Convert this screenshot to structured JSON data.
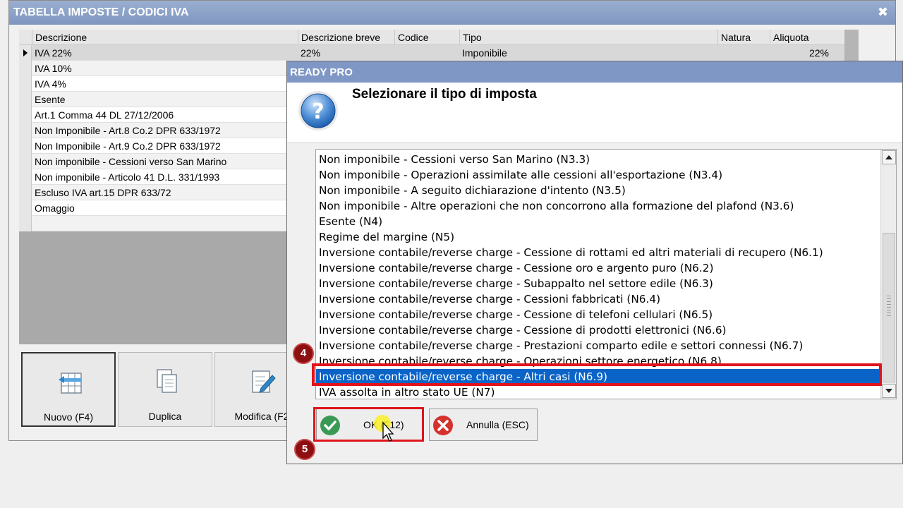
{
  "main_window": {
    "title": "TABELLA IMPOSTE / CODICI IVA",
    "close_glyph": "✖",
    "columns": [
      "Descrizione",
      "Descrizione breve",
      "Codice",
      "Tipo",
      "Natura",
      "Aliquota"
    ],
    "rows": [
      {
        "descrizione": "IVA 22%",
        "descrizione_breve": "22%",
        "codice": "",
        "tipo": "Imponibile",
        "natura": "",
        "aliquota": "22%"
      },
      {
        "descrizione": "IVA 10%"
      },
      {
        "descrizione": "IVA 4%"
      },
      {
        "descrizione": "Esente"
      },
      {
        "descrizione": "Art.1 Comma 44 DL 27/12/2006"
      },
      {
        "descrizione": "Non Imponibile - Art.8 Co.2 DPR 633/1972"
      },
      {
        "descrizione": "Non Imponibile - Art.9 Co.2 DPR 633/1972"
      },
      {
        "descrizione": "Non imponibile - Cessioni verso San Marino"
      },
      {
        "descrizione": "Non imponibile - Articolo 41 D.L. 331/1993"
      },
      {
        "descrizione": "Escluso IVA art.15 DPR 633/72"
      },
      {
        "descrizione": "Omaggio"
      },
      {
        "descrizione": ""
      }
    ],
    "toolbar": [
      {
        "label": "Nuovo (F4)",
        "icon": "new-record-icon"
      },
      {
        "label": "Duplica",
        "icon": "duplicate-icon"
      },
      {
        "label": "Modifica (F2",
        "icon": "edit-icon"
      }
    ]
  },
  "dialog": {
    "title": "READY PRO",
    "prompt": "Selezionare il tipo di imposta",
    "icon": "question-icon",
    "options": [
      "Non imponibile - Cessioni verso San Marino (N3.3)",
      "Non imponibile - Operazioni assimilate alle cessioni all'esportazione (N3.4)",
      "Non imponibile - A seguito dichiarazione d'intento (N3.5)",
      "Non imponibile - Altre operazioni che non concorrono alla formazione del plafond (N3.6)",
      "Esente (N4)",
      "Regime del margine (N5)",
      "Inversione contabile/reverse charge - Cessione di rottami ed altri materiali di recupero (N6.1)",
      "Inversione contabile/reverse charge - Cessione oro e argento puro (N6.2)",
      "Inversione contabile/reverse charge - Subappalto nel settore edile (N6.3)",
      "Inversione contabile/reverse charge - Cessioni fabbricati (N6.4)",
      "Inversione contabile/reverse charge - Cessione di telefoni cellulari (N6.5)",
      "Inversione contabile/reverse charge - Cessione di prodotti elettronici (N6.6)",
      "Inversione contabile/reverse charge - Prestazioni comparto edile e settori connessi (N6.7)",
      "Inversione contabile/reverse charge - Operazioni settore energetico (N6.8)",
      "Inversione contabile/reverse charge - Altri casi (N6.9)",
      "IVA assolta in altro stato UE (N7)"
    ],
    "selected_index": 14,
    "ok_label": "OK (F12)",
    "cancel_label": "Annulla (ESC)"
  },
  "steps": {
    "step4": "4",
    "step5": "5"
  },
  "colors": {
    "title_bar": "#7f97c4",
    "selection": "#0a64c8",
    "highlight": "#e0141a",
    "badge": "#8e0f12"
  }
}
